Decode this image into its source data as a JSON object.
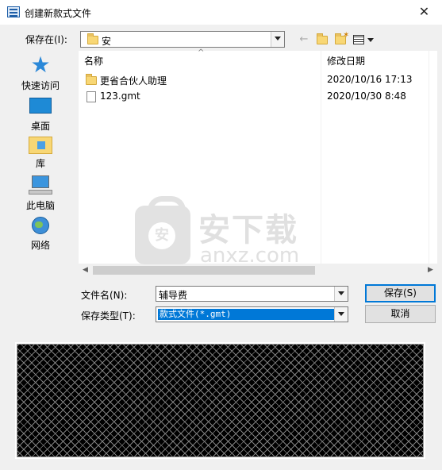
{
  "window": {
    "title": "创建新款式文件",
    "close_glyph": "✕"
  },
  "save_in": {
    "label": "保存在(I):",
    "value": "安"
  },
  "toolbar": {
    "back_icon": "back-arrow-icon",
    "up_icon": "up-folder-icon",
    "new_folder_icon": "new-folder-icon",
    "view_icon": "view-menu-icon"
  },
  "places": [
    {
      "label": "快速访问",
      "icon": "star-icon"
    },
    {
      "label": "桌面",
      "icon": "desktop-icon"
    },
    {
      "label": "库",
      "icon": "library-icon"
    },
    {
      "label": "此电脑",
      "icon": "computer-icon"
    },
    {
      "label": "网络",
      "icon": "network-icon"
    }
  ],
  "file_list": {
    "columns": [
      "名称",
      "修改日期"
    ],
    "sort_glyph": "^",
    "rows": [
      {
        "name": "更省合伙人助理",
        "date": "2020/10/16 17:13",
        "type": "folder"
      },
      {
        "name": "123.gmt",
        "date": "2020/10/30 8:48",
        "type": "file"
      }
    ]
  },
  "watermark": {
    "title": "安下载",
    "subtitle": "anxz.com"
  },
  "filename": {
    "label": "文件名(N):",
    "value": "辅导费"
  },
  "filetype": {
    "label": "保存类型(T):",
    "value": "款式文件(*.gmt)"
  },
  "buttons": {
    "save": "保存(S)",
    "cancel": "取消"
  },
  "colors": {
    "selection": "#0078d7",
    "folder": "#f8d775",
    "preview_bg": "#000000"
  }
}
